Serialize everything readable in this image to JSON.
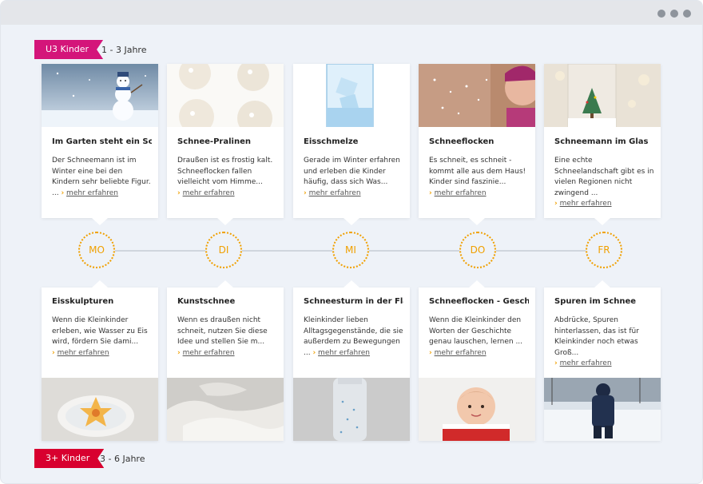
{
  "ribbons": {
    "top": {
      "label": "U3 Kinder",
      "range": "1 - 3 Jahre"
    },
    "bottom": {
      "label": "3+ Kinder",
      "range": "3 - 6 Jahre"
    }
  },
  "colors": {
    "accent": "#f0a000",
    "u3": "#d4157a",
    "k3": "#d8002f",
    "background": "#eef2f8"
  },
  "days": [
    "MO",
    "DI",
    "MI",
    "DO",
    "FR"
  ],
  "more_label": "mehr erfahren",
  "top_cards": [
    {
      "title": "Im Garten steht ein Sc...",
      "text": "Der Schneemann ist im Winter eine bei den Kindern sehr beliebte Figur.",
      "prefix": "... ",
      "image": "snowman"
    },
    {
      "title": "Schnee-Pralinen",
      "text": "Draußen ist es frostig kalt. Schneeflocken fallen vielleicht vom Himme...",
      "prefix": "",
      "image": "snow-pralines"
    },
    {
      "title": "Eisschmelze",
      "text": "Gerade im Winter erfahren und erleben die Kinder häufig, dass sich Was...",
      "prefix": "",
      "image": "ice-glass"
    },
    {
      "title": "Schneeflocken",
      "text": "Es schneit, es schneit - kommt alle aus dem Haus! Kinder sind faszinie...",
      "prefix": "",
      "image": "girl-blowing-snow"
    },
    {
      "title": "Schneemann im Glas",
      "text": "Eine echte Schneelandschaft gibt es in vielen Regionen nicht zwingend ...",
      "prefix": "",
      "image": "snow-globe"
    }
  ],
  "bottom_cards": [
    {
      "title": "Eisskulpturen",
      "text": "Wenn die Kleinkinder erleben, wie Wasser zu Eis wird, fördern Sie dami...",
      "prefix": "",
      "image": "ice-sculpture"
    },
    {
      "title": "Kunstschnee",
      "text": "Wenn es draußen nicht schneit, nutzen Sie diese Idee und stellen Sie m...",
      "prefix": "",
      "image": "artificial-snow"
    },
    {
      "title": "Schneesturm in der Fla...",
      "text": "Kleinkinder lieben Alltagsgegenstände, die sie außerdem zu Bewegungen",
      "prefix": "... ",
      "image": "snow-bottle"
    },
    {
      "title": "Schneeflocken - Gesch...",
      "text": "Wenn die Kleinkinder den Worten der Geschichte genau lauschen, lernen ...",
      "prefix": "",
      "image": "baby-in-snow"
    },
    {
      "title": "Spuren im Schnee",
      "text": "Abdrücke, Spuren hinterlassen, das ist für Kleinkinder noch etwas Groß...",
      "prefix": "",
      "image": "child-in-snow"
    }
  ]
}
